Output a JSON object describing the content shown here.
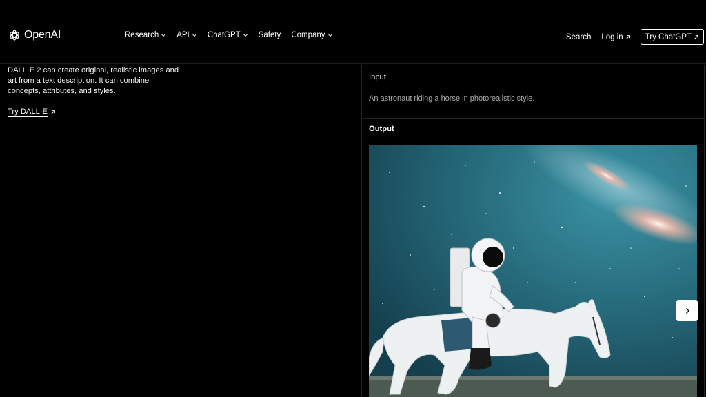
{
  "header": {
    "logo": {
      "text": "OpenAI",
      "icon": "openai-logo-icon"
    },
    "nav": [
      {
        "label": "Research",
        "has_dropdown": true
      },
      {
        "label": "API",
        "has_dropdown": true
      },
      {
        "label": "ChatGPT",
        "has_dropdown": true
      },
      {
        "label": "Safety",
        "has_dropdown": false
      },
      {
        "label": "Company",
        "has_dropdown": true
      }
    ],
    "search_label": "Search",
    "login_label": "Log in",
    "try_chatgpt_label": "Try ChatGPT"
  },
  "intro": {
    "description": "DALL·E 2 can create original, realistic images and art from a text description. It can combine concepts, attributes, and styles.",
    "try_link_label": "Try DALL·E"
  },
  "panel": {
    "input_label": "Input",
    "input_text": "An astronaut riding a horse in photorealistic style.",
    "output_label": "Output",
    "output_image_alt": "astronaut-riding-horse-image",
    "next_icon": "chevron-right-icon"
  },
  "colors": {
    "background": "#000000",
    "text": "#ffffff",
    "muted_text": "#a8a8a8",
    "border": "#262626",
    "image_sky": "#2a6f80"
  }
}
